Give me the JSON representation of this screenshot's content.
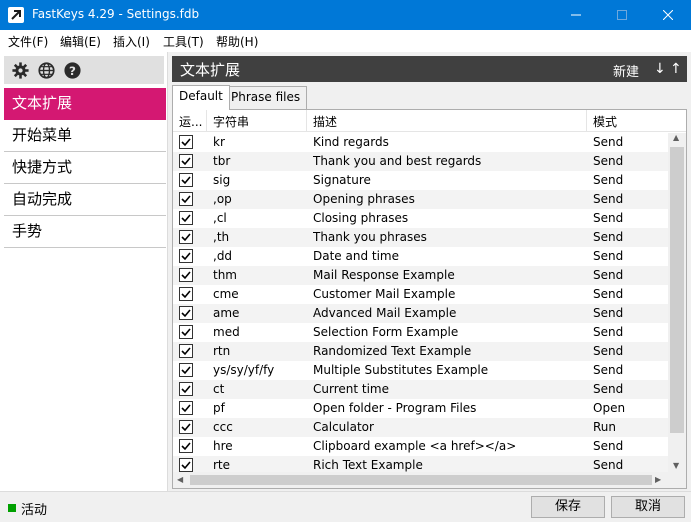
{
  "window": {
    "title": "FastKeys 4.29  - Settings.fdb",
    "app_icon": "arrow-icon",
    "accent_color": "#0078d7"
  },
  "menu": [
    {
      "label": "文件(F)"
    },
    {
      "label": "编辑(E)"
    },
    {
      "label": "插入(I)"
    },
    {
      "label": "工具(T)"
    },
    {
      "label": "帮助(H)"
    }
  ],
  "toolbar_icons": [
    "gear-icon",
    "globe-icon",
    "help-icon"
  ],
  "sidebar": {
    "active_color": "#d41872",
    "items": [
      {
        "label": "文本扩展",
        "active": true
      },
      {
        "label": "开始菜单",
        "active": false
      },
      {
        "label": "快捷方式",
        "active": false
      },
      {
        "label": "自动完成",
        "active": false
      },
      {
        "label": "手势",
        "active": false
      }
    ]
  },
  "panel": {
    "title": "文本扩展",
    "new_label": "新建",
    "down_arrow": "↓",
    "up_arrow": "↑"
  },
  "tabs": [
    {
      "label": "Default",
      "active": true
    },
    {
      "label": "Phrase files",
      "active": false
    }
  ],
  "table": {
    "headers": {
      "run": "运...",
      "abbr": "字符串",
      "desc": "描述",
      "mode": "模式"
    },
    "rows": [
      {
        "checked": true,
        "abbr": "kr",
        "desc": "Kind regards",
        "mode": "Send"
      },
      {
        "checked": true,
        "abbr": "tbr",
        "desc": "Thank you and best regards",
        "mode": "Send"
      },
      {
        "checked": true,
        "abbr": "sig",
        "desc": "Signature",
        "mode": "Send"
      },
      {
        "checked": true,
        "abbr": ",op",
        "desc": "Opening phrases",
        "mode": "Send"
      },
      {
        "checked": true,
        "abbr": ",cl",
        "desc": "Closing phrases",
        "mode": "Send"
      },
      {
        "checked": true,
        "abbr": ",th",
        "desc": "Thank you phrases",
        "mode": "Send"
      },
      {
        "checked": true,
        "abbr": ",dd",
        "desc": "Date and time",
        "mode": "Send"
      },
      {
        "checked": true,
        "abbr": "thm",
        "desc": "Mail Response Example",
        "mode": "Send"
      },
      {
        "checked": true,
        "abbr": "cme",
        "desc": "Customer Mail Example",
        "mode": "Send"
      },
      {
        "checked": true,
        "abbr": "ame",
        "desc": "Advanced Mail Example",
        "mode": "Send"
      },
      {
        "checked": true,
        "abbr": "med",
        "desc": "Selection Form Example",
        "mode": "Send"
      },
      {
        "checked": true,
        "abbr": "rtn",
        "desc": "Randomized Text Example",
        "mode": "Send"
      },
      {
        "checked": true,
        "abbr": "ys/sy/yf/fy",
        "desc": "Multiple Substitutes Example",
        "mode": "Send"
      },
      {
        "checked": true,
        "abbr": "ct",
        "desc": "Current time",
        "mode": "Send"
      },
      {
        "checked": true,
        "abbr": "pf",
        "desc": "Open folder - Program Files",
        "mode": "Open"
      },
      {
        "checked": true,
        "abbr": "ccc",
        "desc": "Calculator",
        "mode": "Run"
      },
      {
        "checked": true,
        "abbr": "hre",
        "desc": "Clipboard example <a href></a>",
        "mode": "Send"
      },
      {
        "checked": true,
        "abbr": "rte",
        "desc": "Rich Text Example",
        "mode": "Send"
      }
    ]
  },
  "status": {
    "text": "活动",
    "indicator_color": "#00a000"
  },
  "buttons": {
    "save": "保存",
    "cancel": "取消"
  }
}
